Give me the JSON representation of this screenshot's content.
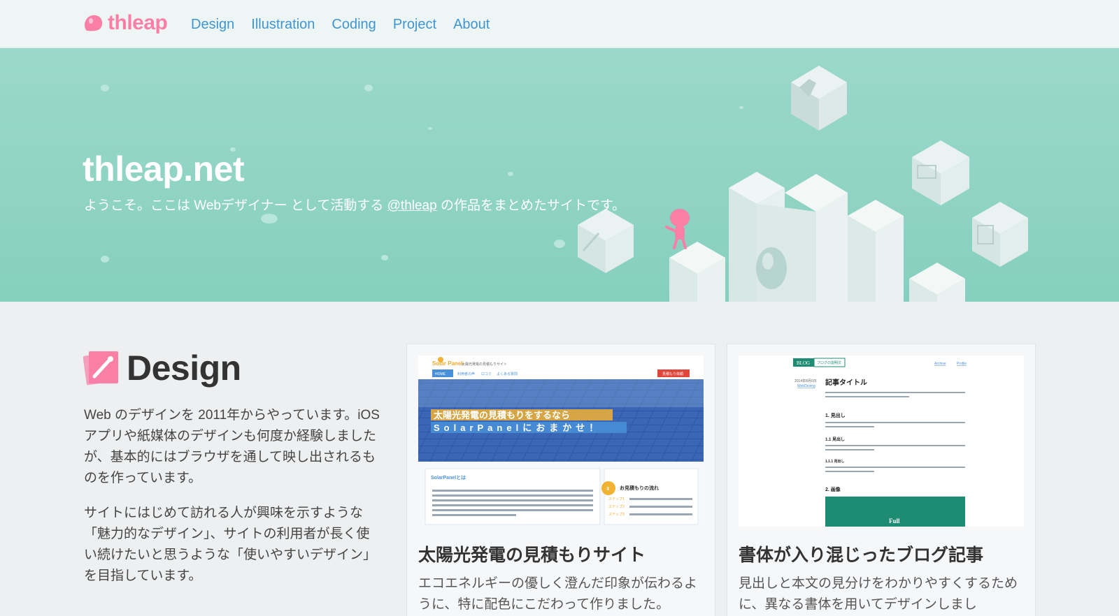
{
  "header": {
    "logo_text": "thleap",
    "nav": [
      "Design",
      "Illustration",
      "Coding",
      "Project",
      "About"
    ]
  },
  "hero": {
    "title": "thleap.net",
    "subtitle_before": "ようこそ。ここは Webデザイナー として活動する ",
    "subtitle_handle": "@thleap",
    "subtitle_after": " の作品をまとめたサイトです。"
  },
  "design": {
    "title": "Design",
    "paragraph1": "Web のデザインを 2011年からやっています。iOS アプリや紙媒体のデザインも何度か経験しましたが、基本的にはブラウザを通して映し出されるものを作っています。",
    "paragraph2": "サイトにはじめて訪れる人が興味を示すような「魅力的なデザイン」、サイトの利用者が長く使い続けたいと思うような「使いやすいデザイン」を目指しています。"
  },
  "cards": [
    {
      "title": "太陽光発電の見積もりサイト",
      "description": "エコエネルギーの優しく澄んだ印象が伝わるように、特に配色にこだわって作りました。",
      "thumb": {
        "site_name": "Solar Panel",
        "site_tagline": "太陽光発電の見積もりサイト",
        "nav": [
          "HOME",
          "利用者の声",
          "ロコミ",
          "よくある質問"
        ],
        "cta": "見積もり依頼",
        "banner_line1": "太陽光発電の見積もりをするなら",
        "banner_line2": "SolarPanelにおまかせ！",
        "section_title": "SolarPanelとは",
        "step_badge": "3",
        "flow_title": "お見積もりの流れ",
        "steps": [
          "ステップ1",
          "ステップ2",
          "ステップ3"
        ]
      }
    },
    {
      "title": "書体が入り混じったブログ記事",
      "description": "見出しと本文の見分けをわかりやすくするために、異なる書体を用いてデザインしまし",
      "thumb": {
        "blog_label": "BLOG",
        "blog_desc": "ブログの説明文",
        "links": [
          "Archive",
          "Profile"
        ],
        "date": "2014年8月6日",
        "category": "WebDesing",
        "article_title": "記事タイトル",
        "h1": "1. 見出し",
        "h2": "1.1 見出し",
        "h3": "1.1.1 見出し",
        "h_image": "2. 画像",
        "image_label": "Full"
      }
    }
  ],
  "colors": {
    "brand_pink": "#f97fa6",
    "nav_blue": "#3f95d4",
    "hero_mint": "#8fd3c3"
  }
}
